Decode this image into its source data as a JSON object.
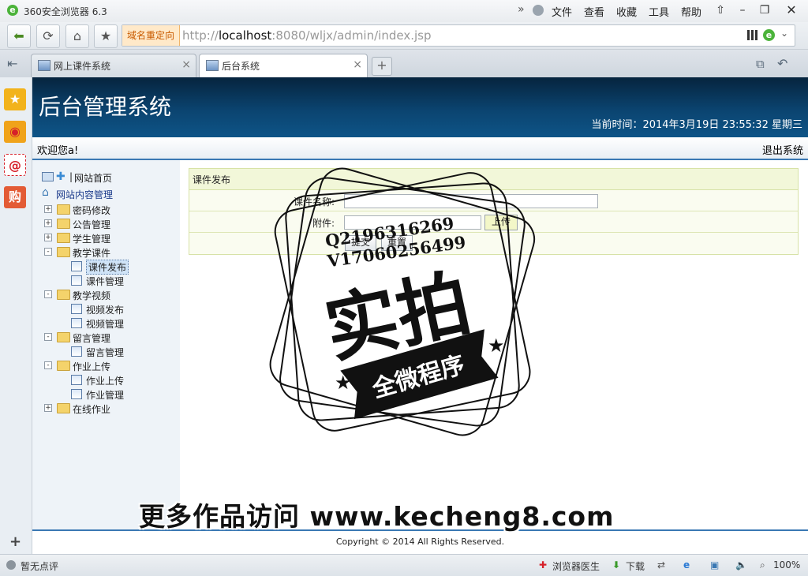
{
  "browser": {
    "app_title": "360安全浏览器 6.3",
    "menu": [
      "文件",
      "查看",
      "收藏",
      "工具",
      "帮助"
    ],
    "redirect_label": "域名重定向",
    "url_prefix": "http://",
    "url_host": "localhost",
    "url_rest": ":8080/wljx/admin/index.jsp",
    "tabs": [
      {
        "label": "网上课件系统",
        "active": false
      },
      {
        "label": "后台系统",
        "active": true
      }
    ],
    "new_tab": "+",
    "sidebar_add": "+",
    "status": {
      "rating": "暂无点评",
      "doctor": "浏览器医生",
      "download": "下载",
      "zoom": "100%"
    }
  },
  "page": {
    "title": "后台管理系统",
    "time": "当前时间：2014年3月19日 23:55:32 星期三",
    "welcome": "欢迎您a!",
    "logout": "退出系统",
    "home_link": "网站首页",
    "tree_root": "网站内容管理",
    "tree": [
      {
        "label": "密码修改",
        "type": "folder",
        "expander": "+"
      },
      {
        "label": "公告管理",
        "type": "folder",
        "expander": "+"
      },
      {
        "label": "学生管理",
        "type": "folder",
        "expander": "+"
      },
      {
        "label": "教学课件",
        "type": "folder",
        "expander": "-"
      },
      {
        "label": "课件发布",
        "type": "leaf",
        "selected": true
      },
      {
        "label": "课件管理",
        "type": "leaf"
      },
      {
        "label": "教学视频",
        "type": "folder",
        "expander": "-"
      },
      {
        "label": "视频发布",
        "type": "leaf"
      },
      {
        "label": "视频管理",
        "type": "leaf"
      },
      {
        "label": "留言管理",
        "type": "folder",
        "expander": "-"
      },
      {
        "label": "留言管理",
        "type": "leaf"
      },
      {
        "label": "作业上传",
        "type": "folder",
        "expander": "-"
      },
      {
        "label": "作业上传",
        "type": "leaf"
      },
      {
        "label": "作业管理",
        "type": "leaf"
      },
      {
        "label": "在线作业",
        "type": "folder",
        "expander": "+"
      }
    ],
    "form": {
      "title": "课件发布",
      "name_label": "课件名称:",
      "name_value": "",
      "attach_label": "附件:",
      "attach_value": "",
      "upload_label": "上传",
      "submit_label": "提交",
      "reset_label": "重置"
    },
    "copyright": "Copyright © 2014 All Rights Reserved."
  },
  "watermark": {
    "contact_q": "Q2196316269",
    "contact_v": "V17060256499",
    "stamp_main": "实拍",
    "stamp_ribbon": "全微程序",
    "footer_text": "更多作品访问 www.kecheng8.com"
  },
  "colors": {
    "banner_dark": "#06243e",
    "banner_light": "#0e5487",
    "accent_blue": "#3a78b3",
    "form_bg": "#fafcf0",
    "redirect_orange": "#c95b00"
  }
}
